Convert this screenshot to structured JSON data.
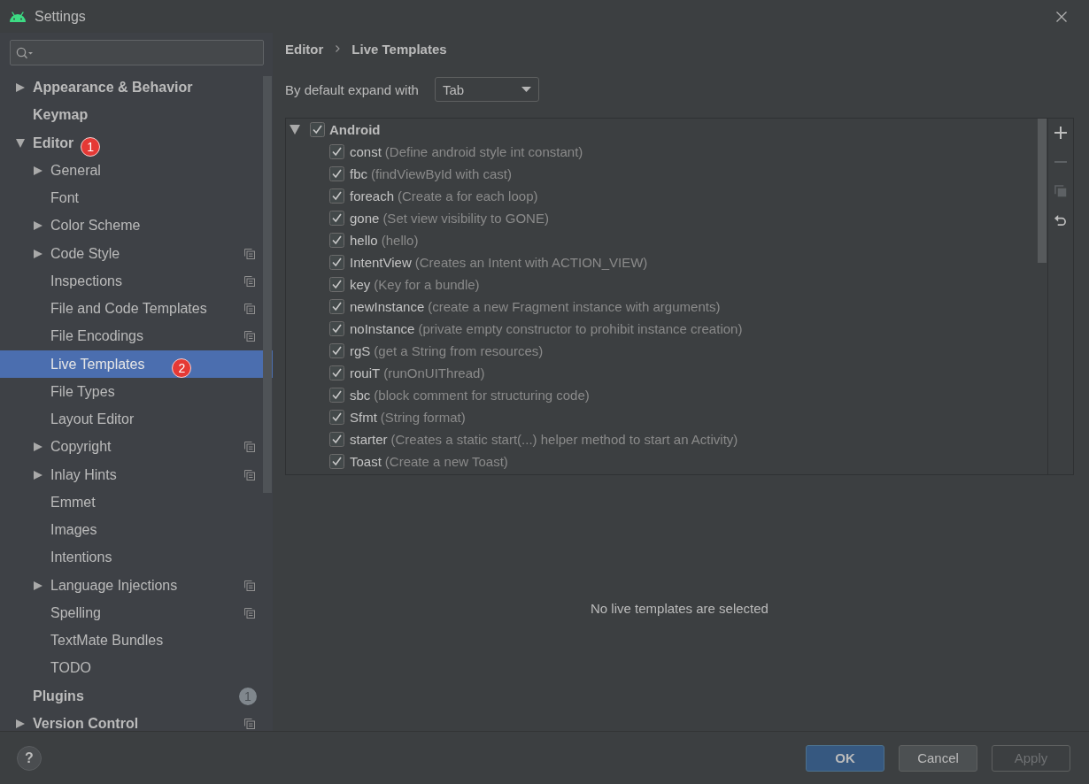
{
  "window": {
    "title": "Settings"
  },
  "sidebar": {
    "items": [
      {
        "label": "Appearance & Behavior",
        "expanded": false,
        "selected": false,
        "project_level": false
      },
      {
        "label": "Keymap",
        "selected": false,
        "project_level": false
      },
      {
        "label": "Editor",
        "expanded": true,
        "selected": false,
        "project_level": false,
        "callout": "1",
        "children": [
          {
            "label": "General",
            "expanded": false,
            "selected": false,
            "project_level": false
          },
          {
            "label": "Font",
            "selected": false,
            "project_level": false
          },
          {
            "label": "Color Scheme",
            "expanded": false,
            "selected": false,
            "project_level": false
          },
          {
            "label": "Code Style",
            "expanded": false,
            "selected": false,
            "project_level": true
          },
          {
            "label": "Inspections",
            "selected": false,
            "project_level": true
          },
          {
            "label": "File and Code Templates",
            "selected": false,
            "project_level": true
          },
          {
            "label": "File Encodings",
            "selected": false,
            "project_level": true
          },
          {
            "label": "Live Templates",
            "selected": true,
            "project_level": false,
            "callout": "2"
          },
          {
            "label": "File Types",
            "selected": false,
            "project_level": false
          },
          {
            "label": "Layout Editor",
            "selected": false,
            "project_level": false
          },
          {
            "label": "Copyright",
            "expanded": false,
            "selected": false,
            "project_level": true
          },
          {
            "label": "Inlay Hints",
            "expanded": false,
            "selected": false,
            "project_level": true
          },
          {
            "label": "Emmet",
            "selected": false,
            "project_level": false
          },
          {
            "label": "Images",
            "selected": false,
            "project_level": false
          },
          {
            "label": "Intentions",
            "selected": false,
            "project_level": false
          },
          {
            "label": "Language Injections",
            "expanded": false,
            "selected": false,
            "project_level": true
          },
          {
            "label": "Spelling",
            "selected": false,
            "project_level": true
          },
          {
            "label": "TextMate Bundles",
            "selected": false,
            "project_level": false
          },
          {
            "label": "TODO",
            "selected": false,
            "project_level": false
          }
        ]
      },
      {
        "label": "Plugins",
        "selected": false,
        "project_level": false,
        "badge": "1"
      },
      {
        "label": "Version Control",
        "expanded": false,
        "selected": false,
        "project_level": true
      }
    ]
  },
  "breadcrumb": [
    "Editor",
    "Live Templates"
  ],
  "expand_with": {
    "label": "By default expand with",
    "value": "Tab"
  },
  "templates": {
    "groups": [
      {
        "name": "Android",
        "checked": true,
        "expanded": true,
        "items": [
          {
            "abbreviation": "const",
            "description": "(Define android style int constant)",
            "checked": true
          },
          {
            "abbreviation": "fbc",
            "description": "(findViewById with cast)",
            "checked": true
          },
          {
            "abbreviation": "foreach",
            "description": "(Create a for each loop)",
            "checked": true
          },
          {
            "abbreviation": "gone",
            "description": "(Set view visibility to GONE)",
            "checked": true
          },
          {
            "abbreviation": "hello",
            "description": "(hello)",
            "checked": true
          },
          {
            "abbreviation": "IntentView",
            "description": "(Creates an Intent with ACTION_VIEW)",
            "checked": true
          },
          {
            "abbreviation": "key",
            "description": "(Key for a bundle)",
            "checked": true
          },
          {
            "abbreviation": "newInstance",
            "description": "(create a new Fragment instance with arguments)",
            "checked": true
          },
          {
            "abbreviation": "noInstance",
            "description": "(private empty constructor to prohibit instance creation)",
            "checked": true
          },
          {
            "abbreviation": "rgS",
            "description": "(get a String from resources)",
            "checked": true
          },
          {
            "abbreviation": "rouiT",
            "description": "(runOnUIThread)",
            "checked": true
          },
          {
            "abbreviation": "sbc",
            "description": "(block comment for structuring code)",
            "checked": true
          },
          {
            "abbreviation": "Sfmt",
            "description": "(String format)",
            "checked": true
          },
          {
            "abbreviation": "starter",
            "description": "(Creates a static start(...) helper method to start an Activity)",
            "checked": true
          },
          {
            "abbreviation": "Toast",
            "description": "(Create a new Toast)",
            "checked": true
          }
        ]
      }
    ]
  },
  "toolbar": [
    {
      "kind": "add",
      "disabled": false
    },
    {
      "kind": "remove",
      "disabled": true
    },
    {
      "kind": "copy",
      "disabled": true
    },
    {
      "kind": "revert",
      "disabled": false
    }
  ],
  "details": {
    "message": "No live templates are selected"
  },
  "help": "?",
  "buttons": [
    {
      "label": "OK",
      "kind": "ok",
      "disabled": false
    },
    {
      "label": "Cancel",
      "kind": "cancel",
      "disabled": false
    },
    {
      "label": "Apply",
      "kind": "apply",
      "disabled": true
    }
  ]
}
